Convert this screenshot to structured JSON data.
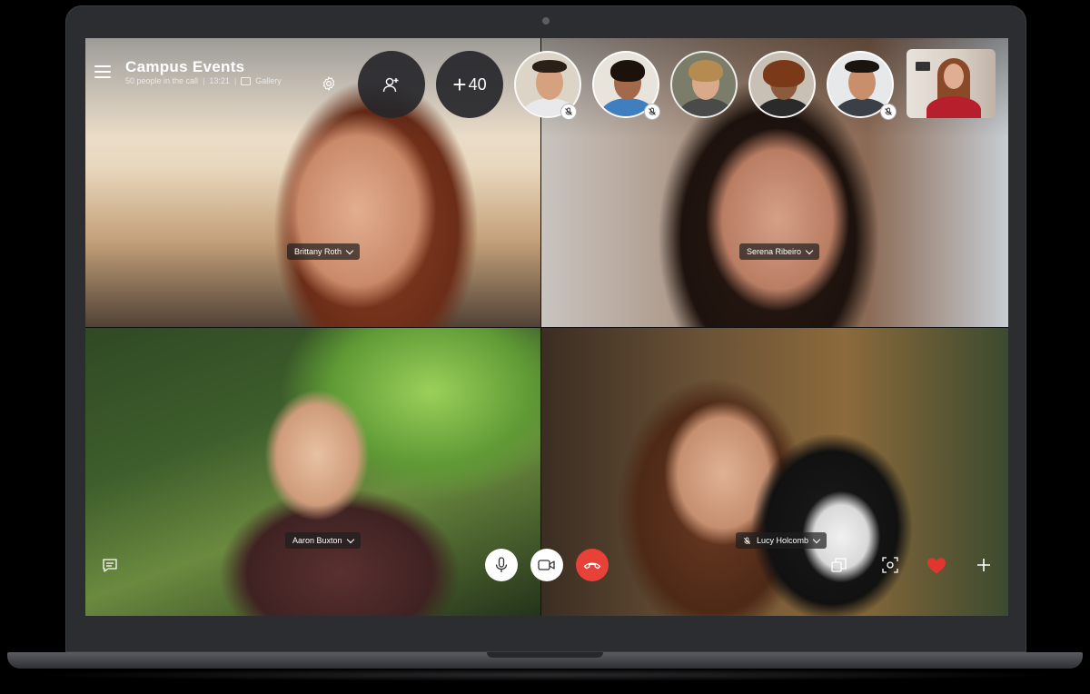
{
  "window": {
    "title": "Campus Events",
    "people_info": "50 people in the call",
    "time": "13:21",
    "view_label": "Gallery"
  },
  "header": {
    "more_participants": "40"
  },
  "participants": [
    {
      "name": "Brittany Roth"
    },
    {
      "name": "Serena Ribeiro"
    },
    {
      "name": "Aaron Buxton"
    },
    {
      "name": "Lucy Holcomb"
    }
  ],
  "icons": {
    "menu": "hamburger-menu-icon",
    "settings": "gear-icon",
    "add_people": "add-person-icon",
    "chat": "chat-icon",
    "mic": "microphone-icon",
    "video": "video-camera-icon",
    "hangup": "end-call-icon",
    "switch_camera": "switch-camera-icon",
    "snapshot": "snapshot-icon",
    "react": "heart-icon",
    "more": "plus-icon"
  },
  "colors": {
    "end_call": "#e74138",
    "heart": "#e2352f",
    "call_bar": "#262629"
  }
}
